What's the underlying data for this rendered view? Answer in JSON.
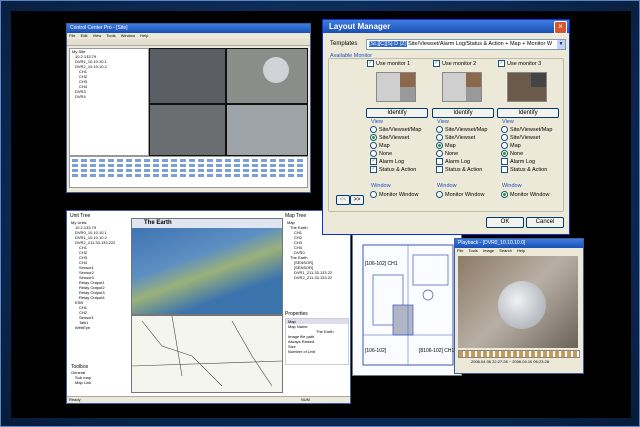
{
  "layout_manager": {
    "title": "Layout Manager",
    "close": "×",
    "templates_label": "Templates",
    "template_prefix": "[SL][C][S] D (Z)",
    "template_value": "Site/Viewset/Alarm Log/Status & Action + Map + Monitor W",
    "available_label": "Available Monitor",
    "monitors": [
      {
        "label": "Use monitor 1",
        "identify": "Identify",
        "view_label": "View",
        "window_label": "Window",
        "views": [
          "Site/Viewset/Map",
          "Site/Viewset",
          "Map",
          "None",
          "Alarm Log",
          "Status & Action"
        ],
        "window": "Monitor Window"
      },
      {
        "label": "Use monitor 2",
        "identify": "Identify",
        "view_label": "View",
        "window_label": "Window",
        "views": [
          "Site/Viewset/Map",
          "Site/Viewset",
          "Map",
          "None",
          "Alarm Log",
          "Status & Action"
        ],
        "window": "Monitor Window"
      },
      {
        "label": "Use monitor 3",
        "identify": "Identify",
        "view_label": "View",
        "window_label": "Window",
        "views": [
          "Site/Viewset/Map",
          "Site/Viewset",
          "Map",
          "None",
          "Alarm Log",
          "Status & Action"
        ],
        "window": "Monitor Window"
      }
    ],
    "prev": "<<",
    "next": ">>",
    "ok": "OK",
    "cancel": "Cancel"
  },
  "main_window": {
    "title": "Control Center Pro - [Site]",
    "menu": [
      "File",
      "Edit",
      "View",
      "Tools",
      "Window",
      "Help"
    ],
    "tree": [
      "My Site",
      "10.2.133.79",
      "DVR1_10.10.10.1",
      "DVR2_10.10.10.2",
      "CH1",
      "CH2",
      "CH3",
      "CH4",
      "DVR3",
      "DVR4"
    ]
  },
  "map_window": {
    "tree_title": "Unit Tree",
    "tree": [
      "My Units",
      "10.2.133.79",
      "DVR0_10.10.10.1",
      "DVR1_10.10.10.2",
      "DVR2_211.33.133.222",
      "CH1",
      "CH2",
      "CH3",
      "CH4",
      "Sensor1",
      "Sensor2",
      "Sensor3",
      "Relay Output1",
      "Relay Output2",
      "Relay Output3",
      "Relay Output4",
      "ESB",
      "CH1",
      "CH2",
      "Sensor1",
      "Talk1",
      "WebEye"
    ],
    "map_title": "The Earth",
    "map_tree_title": "Map Tree",
    "map_tree": [
      "Map",
      "The Earth",
      "CH1",
      "CH2",
      "CH3",
      "CH4",
      "DVR0",
      "The Earth",
      "[SENSOR]",
      "[SENSOR]",
      "DVR1_211.33.133.22",
      "DVR2_211.33.133.22"
    ],
    "properties_title": "Properties",
    "properties": [
      "Map",
      "Map Name",
      "The Earth",
      "Image file path",
      "Always Raised",
      "Size",
      "Number of Unit"
    ],
    "toolbox_title": "Toolbox",
    "toolbox": [
      "General",
      "Sub map",
      "Map Link"
    ],
    "status_left": "Ready",
    "status_right": "NUM"
  },
  "floor_plan": {
    "labels": [
      "[106-102] CH1",
      "[8106-102] CH1",
      "[106-102]"
    ]
  },
  "playback": {
    "title": "Playback - [DVR0_10.10.10.0]",
    "menu": [
      "File",
      "Tools",
      "Image",
      "Search",
      "Help"
    ],
    "timestamp": "2006.04.06 22:27:28 ~ 2006.04.10 05:23:28"
  },
  "colors": {
    "titlebar": "#1a4fb4",
    "background": "#0d2a52",
    "dialog": "#ece9d8",
    "accent_blue": "#1f4fbf"
  }
}
